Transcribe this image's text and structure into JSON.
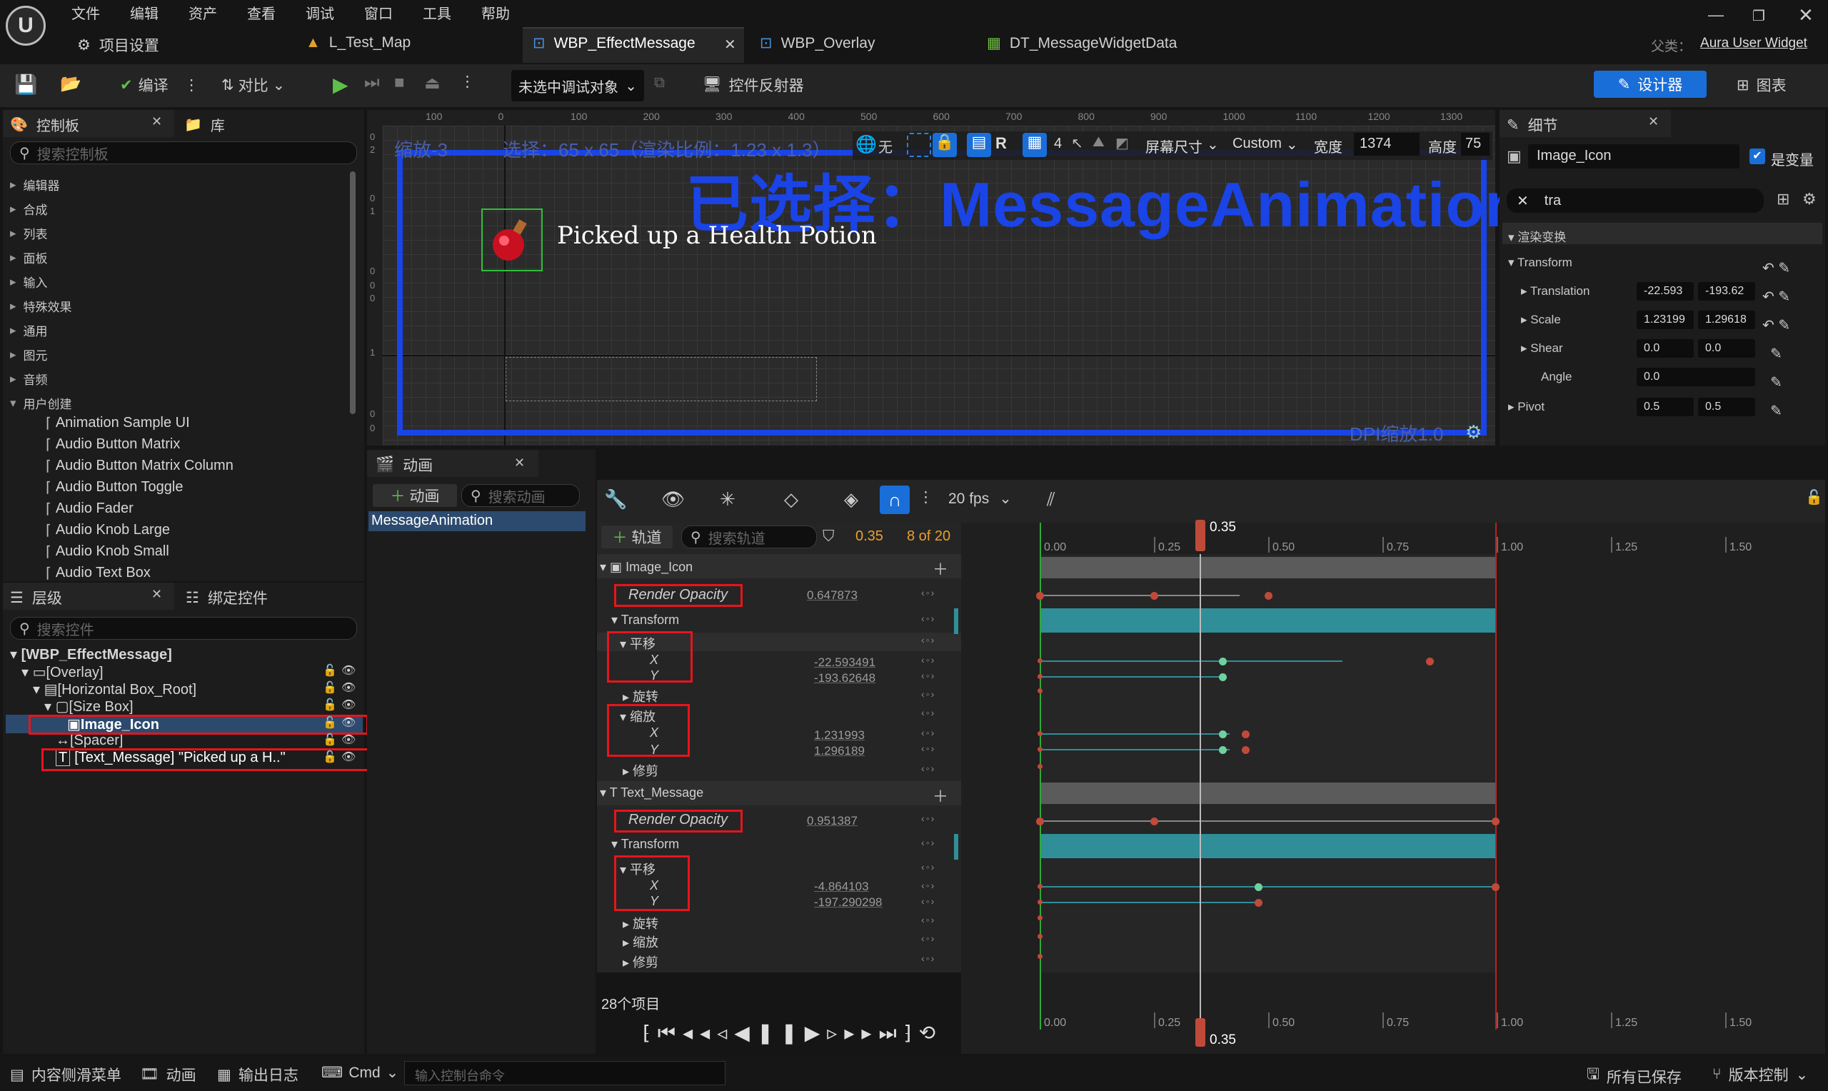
{
  "menu": [
    "文件",
    "编辑",
    "资产",
    "查看",
    "调试",
    "窗口",
    "工具",
    "帮助"
  ],
  "tabs": {
    "project_settings": "项目设置",
    "map": "L_Test_Map",
    "active": "WBP_EffectMessage",
    "overlay": "WBP_Overlay",
    "datatable": "DT_MessageWidgetData",
    "parent_label": "父类：",
    "parent_value": "Aura User Widget"
  },
  "toolbar": {
    "compile": "编译",
    "diff": "对比",
    "debug_target": "未选中调试对象",
    "reflector": "控件反射器",
    "designer": "设计器",
    "graph": "图表"
  },
  "palette": {
    "tab": "控制板",
    "library": "库",
    "search_placeholder": "搜索控制板",
    "categories": [
      "编辑器",
      "合成",
      "列表",
      "面板",
      "输入",
      "特殊效果",
      "通用",
      "图元",
      "音频",
      "用户创建"
    ],
    "widgets": [
      "Animation Sample UI",
      "Audio Button Matrix",
      "Audio Button Matrix Column",
      "Audio Button Toggle",
      "Audio Fader",
      "Audio Knob Large",
      "Audio Knob Small",
      "Audio Text Box"
    ]
  },
  "hierarchy": {
    "tab": "层级",
    "bind_tab": "绑定控件",
    "search_placeholder": "搜索控件",
    "items": [
      "[WBP_EffectMessage]",
      "[Overlay]",
      "[Horizontal Box_Root]",
      "[Size Box]",
      "Image_Icon",
      "[Spacer]",
      "[Text_Message] \"Picked up a H..\""
    ]
  },
  "viewport": {
    "zoom_label": "缩放-3",
    "selection_info": "选择：65 x 65（渲染比例：1.23 x 1.3）",
    "none_label": "无",
    "grid_value": "4",
    "screen_size": "屏幕尺寸",
    "custom": "Custom",
    "width_label": "宽度",
    "width_value": "1374",
    "height_label": "高度",
    "height_value": "75",
    "big_text": "已选择：MessageAnimation",
    "message": "Picked up a Health Potion",
    "dpi": "DPI缩放1.0",
    "ruler_h": [
      "100",
      "0",
      "100",
      "200",
      "300",
      "400",
      "500",
      "600",
      "700",
      "800",
      "900",
      "1000",
      "1100",
      "1200",
      "1300"
    ],
    "ruler_v": [
      "0",
      "2",
      "0",
      "1",
      "0",
      "0",
      "0",
      "1",
      "0",
      "0"
    ]
  },
  "details": {
    "tab": "细节",
    "name_value": "Image_Icon",
    "is_variable": "是变量",
    "search_value": "tra",
    "section": "渲染变换",
    "transform": "Transform",
    "translation_label": "Translation",
    "translation_x": "-22.593",
    "translation_y": "-193.62",
    "scale_label": "Scale",
    "scale_x": "1.23199",
    "scale_y": "1.29618",
    "shear_label": "Shear",
    "shear_x": "0.0",
    "shear_y": "0.0",
    "angle_label": "Angle",
    "angle_value": "0.0",
    "pivot_label": "Pivot",
    "pivot_x": "0.5",
    "pivot_y": "0.5"
  },
  "animations": {
    "tab": "动画",
    "add": "动画",
    "search_placeholder": "搜索动画",
    "list": [
      "MessageAnimation"
    ]
  },
  "sequencer": {
    "fps": "20 fps",
    "add_track": "轨道",
    "search_placeholder": "搜索轨道",
    "current_time": "0.35",
    "frame_count": "8 of 20",
    "playhead": "0.35",
    "items_count": "28个项目",
    "ruler": [
      "0.00",
      "0.25",
      "0.50",
      "0.75",
      "1.00",
      "1.25",
      "1.50"
    ],
    "tracks": {
      "image_icon": "Image_Icon",
      "render_opacity": "Render Opacity",
      "opacity_value_1": "0.647873",
      "transform": "Transform",
      "translate": "平移",
      "x": "X",
      "y": "Y",
      "tx_value": "-22.593491",
      "ty_value": "-193.62648",
      "rotate": "旋转",
      "scale": "缩放",
      "sx_value": "1.231993",
      "sy_value": "1.296189",
      "shear": "修剪",
      "text_message": "Text_Message",
      "opacity_value_2": "0.951387",
      "tx2_value": "-4.864103",
      "ty2_value": "-197.290298"
    }
  },
  "statusbar": {
    "content_drawer": "内容侧滑菜单",
    "animation": "动画",
    "output_log": "输出日志",
    "cmd": "Cmd",
    "console_placeholder": "输入控制台命令",
    "all_saved": "所有已保存",
    "version_control": "版本控制"
  },
  "colors": {
    "accent": "#1a6ed8",
    "red_box": "#e8141c",
    "teal": "#2f8e98",
    "viewport_blue": "#1a44e6"
  }
}
